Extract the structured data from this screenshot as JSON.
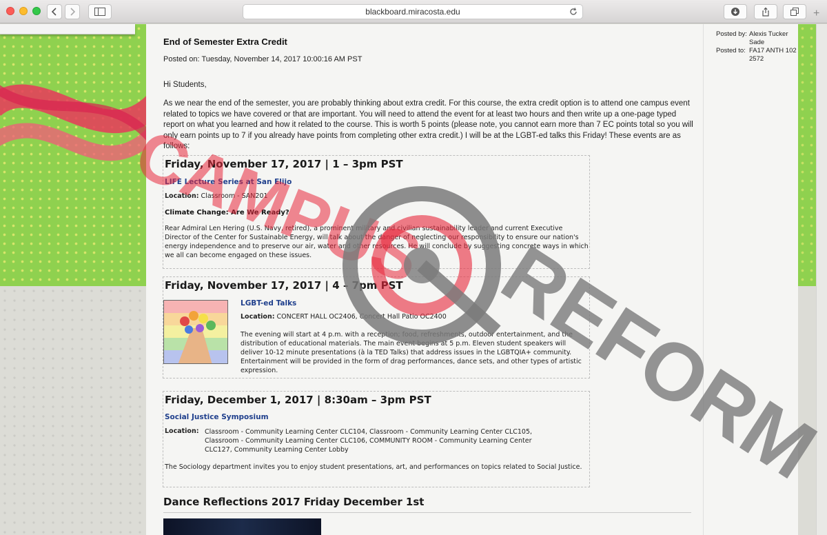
{
  "browser": {
    "url": "blackboard.miracosta.edu",
    "new_tab_label": "+"
  },
  "sidebar": {
    "posted_by_label": "Posted by:",
    "posted_by_name": "Alexis Tucker Sade",
    "posted_to_label": "Posted to:",
    "posted_to_course": "FA17 ANTH 102 2572"
  },
  "announcement": {
    "title": "End of Semester Extra Credit",
    "posted_on": "Posted on: Tuesday, November 14, 2017 10:00:16 AM PST",
    "greeting": "Hi Students,",
    "intro": "As we near the end of the semester, you are probably thinking about extra credit. For this course, the extra credit option is to attend one campus event related to topics we have covered or that are important. You will need to attend the event for at least two hours and then write up a one-page typed report on what you learned and how it related to the course. This is worth 5 points (please note, you cannot earn more than 7 EC points total so you will only earn points up to 7 if you already have points from completing other extra credit.) I will be at the LGBT-ed talks this Friday! These events are as follows:"
  },
  "events": [
    {
      "heading": "Friday, November 17, 2017 | 1 – 3pm PST",
      "link": "LIFE Lecture Series at San Elijo",
      "location_label": "Location:",
      "location": "Classroom - SAN201",
      "subtitle": "Climate Change: Are We Ready?",
      "body": "Rear Admiral Len Hering (U.S. Navy, retired), a prominent military and civilian sustainability leader and current Executive Director of the Center for Sustainable Energy, will talk about the danger of neglecting our responsibility to ensure our nation's energy independence and to preserve our air, water and other resources. He will conclude by suggesting concrete ways in which we all can become engaged on these issues."
    },
    {
      "heading": "Friday, November 17, 2017 | 4 – 7pm PST",
      "link": "LGBT-ed Talks",
      "location_label": "Location:",
      "location": "CONCERT HALL OC2406, Concert Hall Patio OC2400",
      "body": "The evening will start at 4 p.m. with a reception; food, refreshments, outdoor entertainment, and the distribution of educational materials. The main event begins at 5 p.m. Eleven student speakers will deliver 10-12 minute presentations (à la TED Talks) that address issues in the LGBTQIA+ community. Entertainment will be provided in the form of drag performances, dance sets, and other types of artistic expression."
    },
    {
      "heading": "Friday, December 1, 2017 | 8:30am – 3pm PST",
      "link": "Social Justice Symposium",
      "location_label": "Location:",
      "location_lines": [
        "Classroom - Community Learning Center CLC104, Classroom - Community Learning Center CLC105,",
        "Classroom - Community Learning Center CLC106, COMMUNITY ROOM - Community Learning Center",
        "CLC127, Community Learning Center Lobby"
      ],
      "body": "The Sociology department invites you to enjoy student presentations, art, and performances on topics related to Social Justice."
    }
  ],
  "next_heading": "Dance Reflections 2017 Friday December 1st",
  "watermark": {
    "word_left": "CAMPUS",
    "word_right": "REFORM"
  }
}
